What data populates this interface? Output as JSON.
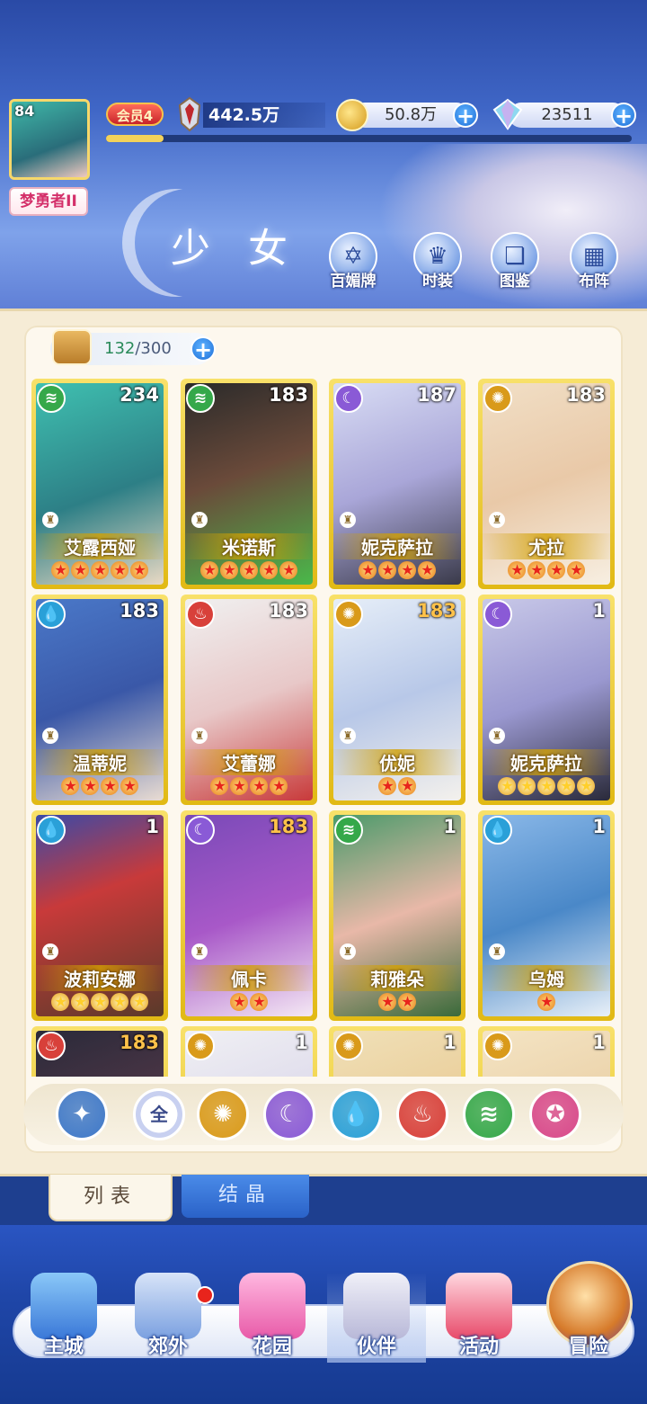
{
  "header": {
    "level": "84",
    "nickname": "梦勇者II",
    "vip_label": "会员4",
    "vip_progress": 0.11,
    "power": "442.5万",
    "coins": "50.8万",
    "gems": "23511",
    "title": "少 女"
  },
  "quick_actions": [
    {
      "label": "百媚牌",
      "icon": "card-deck-icon"
    },
    {
      "label": "时装",
      "icon": "costume-icon"
    },
    {
      "label": "图鉴",
      "icon": "book-icon"
    },
    {
      "label": "布阵",
      "icon": "formation-grid-icon"
    }
  ],
  "capacity": {
    "current": "132",
    "max": "/300"
  },
  "characters": [
    {
      "name": "艾露西娅",
      "level": "234",
      "element": "wind",
      "stars": 5,
      "star_color": "red"
    },
    {
      "name": "米诺斯",
      "level": "183",
      "element": "wind",
      "stars": 5,
      "star_color": "red"
    },
    {
      "name": "妮克萨拉",
      "level": "187",
      "element": "moon",
      "stars": 4,
      "star_color": "red"
    },
    {
      "name": "尤拉",
      "level": "183",
      "element": "sun",
      "stars": 4,
      "star_color": "red"
    },
    {
      "name": "温蒂妮",
      "level": "183",
      "element": "water",
      "stars": 4,
      "star_color": "red"
    },
    {
      "name": "艾蕾娜",
      "level": "183",
      "element": "fire",
      "stars": 4,
      "star_color": "red"
    },
    {
      "name": "优妮",
      "level": "183",
      "element": "sun",
      "stars": 2,
      "star_color": "red"
    },
    {
      "name": "妮克萨拉",
      "level": "1",
      "element": "moon",
      "stars": 5,
      "star_color": "gold"
    },
    {
      "name": "波莉安娜",
      "level": "1",
      "element": "water",
      "stars": 5,
      "star_color": "gold"
    },
    {
      "name": "佩卡",
      "level": "183",
      "element": "moon",
      "stars": 2,
      "star_color": "red"
    },
    {
      "name": "莉雅朵",
      "level": "1",
      "element": "wind",
      "stars": 2,
      "star_color": "red"
    },
    {
      "name": "乌姆",
      "level": "1",
      "element": "water",
      "stars": 1,
      "star_color": "red"
    },
    {
      "name": "",
      "level": "183",
      "element": "fire",
      "stars": 0,
      "star_color": "red"
    },
    {
      "name": "",
      "level": "1",
      "element": "sun",
      "stars": 0,
      "star_color": "red"
    },
    {
      "name": "",
      "level": "1",
      "element": "sun",
      "stars": 0,
      "star_color": "red"
    },
    {
      "name": "",
      "level": "1",
      "element": "sun",
      "stars": 0,
      "star_color": "red"
    }
  ],
  "filters": [
    {
      "key": "role",
      "label": "",
      "icon": "class-filter-icon",
      "color": "#3e78c8"
    },
    {
      "key": "all",
      "label": "全",
      "icon": "all-filter-icon",
      "color": "#8a9ad8"
    },
    {
      "key": "sun",
      "label": "",
      "icon": "sun-element-icon",
      "color": "#d99a1a"
    },
    {
      "key": "moon",
      "label": "",
      "icon": "moon-element-icon",
      "color": "#8a5ad6"
    },
    {
      "key": "water",
      "label": "",
      "icon": "water-element-icon",
      "color": "#2aa0d8"
    },
    {
      "key": "fire",
      "label": "",
      "icon": "fire-element-icon",
      "color": "#d8403a"
    },
    {
      "key": "wind",
      "label": "",
      "icon": "wind-element-icon",
      "color": "#35a84a"
    },
    {
      "key": "star",
      "label": "",
      "icon": "star-element-icon",
      "color": "#d8488a"
    }
  ],
  "tabs": {
    "list": "列表",
    "crystal": "结晶"
  },
  "nav": [
    {
      "label": "主城",
      "icon": "castle-icon"
    },
    {
      "label": "郊外",
      "icon": "outskirts-icon"
    },
    {
      "label": "花园",
      "icon": "garden-heart-icon"
    },
    {
      "label": "伙伴",
      "icon": "partner-icon"
    },
    {
      "label": "活动",
      "icon": "gift-box-icon"
    },
    {
      "label": "冒险",
      "icon": "adventure-compass-icon"
    }
  ],
  "element_colors": {
    "wind": "#35a84a",
    "moon": "#8a5ad6",
    "sun": "#d99a1a",
    "water": "#2aa0d8",
    "fire": "#d8403a"
  }
}
